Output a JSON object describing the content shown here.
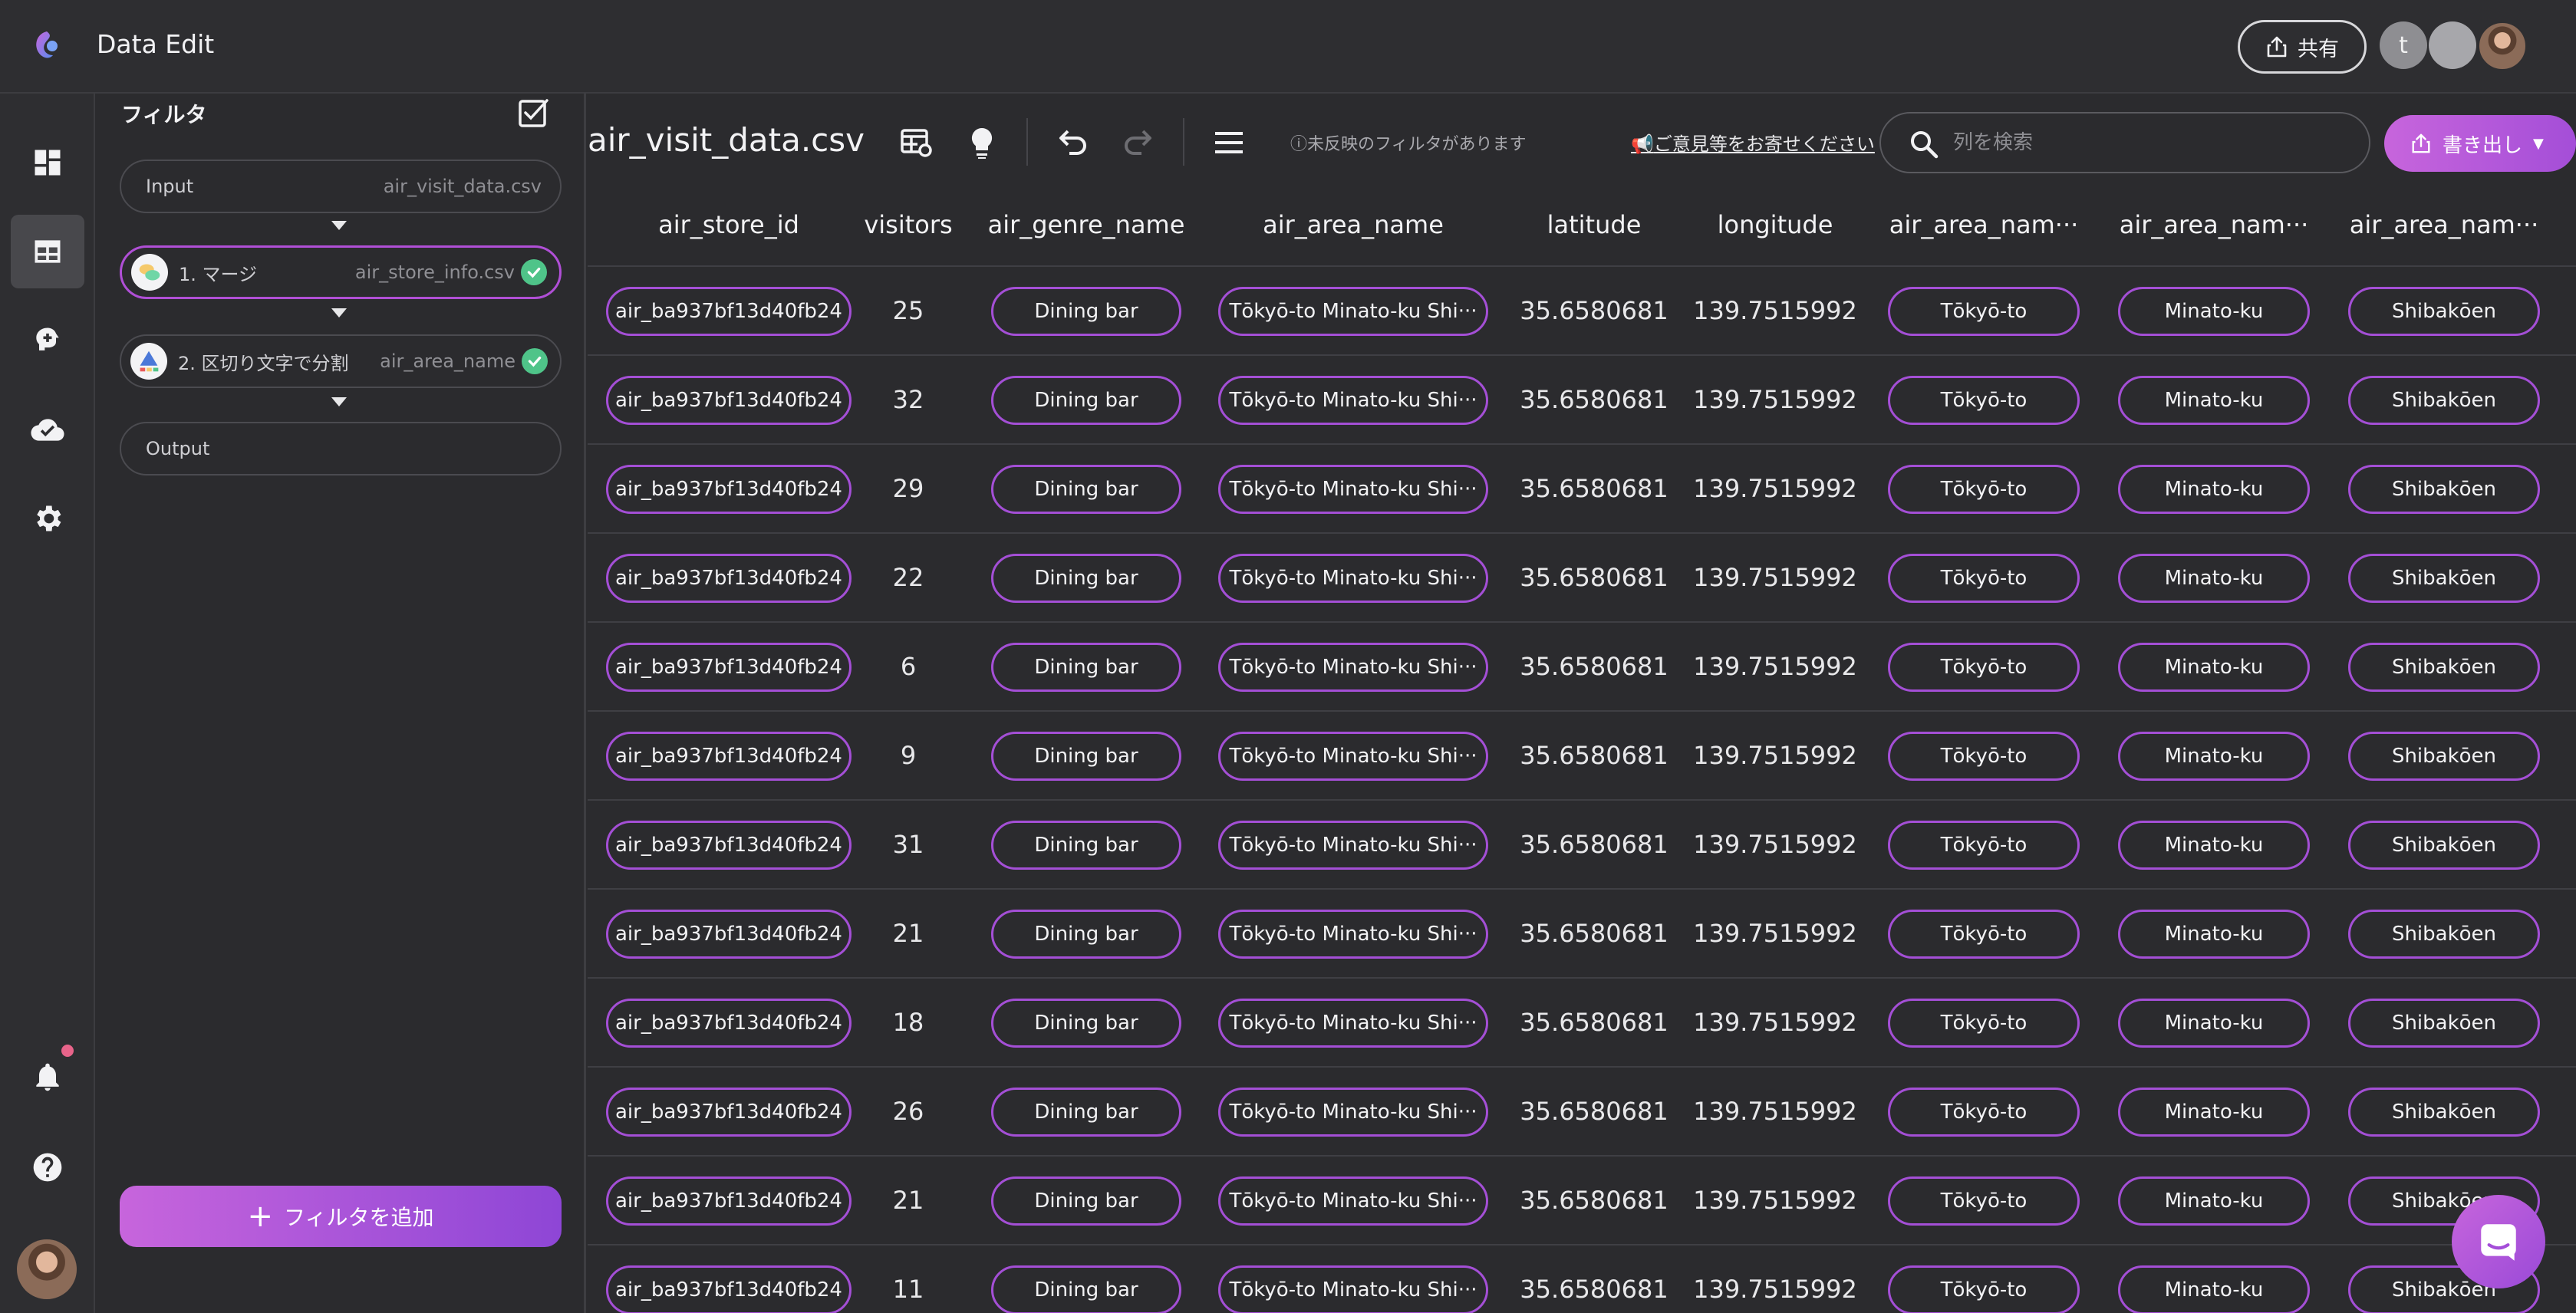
{
  "header": {
    "app_title": "Data Edit",
    "share_label": "共有",
    "user_initial": "t"
  },
  "filter_panel": {
    "title": "フィルタ",
    "input": {
      "label": "Input",
      "file": "air_visit_data.csv"
    },
    "steps": [
      {
        "label": "1. マージ",
        "detail": "air_store_info.csv"
      },
      {
        "label": "2. 区切り文字で分割",
        "detail": "air_area_name"
      }
    ],
    "output": {
      "label": "Output"
    },
    "add_filter_label": "フィルタを追加"
  },
  "toolbar": {
    "file_title": "air_visit_data.csv",
    "unapplied_notice": "ⓘ未反映のフィルタがあります",
    "feedback_link": "ご意見等をお寄せください",
    "search_placeholder": "列を検索",
    "export_label": "書き出し"
  },
  "table": {
    "columns": [
      "air_store_id",
      "visitors",
      "air_genre_name",
      "air_area_name",
      "latitude",
      "longitude",
      "air_area_nam···",
      "air_area_nam···",
      "air_area_nam···"
    ],
    "rows": [
      [
        "air_ba937bf13d40fb24",
        "25",
        "Dining bar",
        "Tōkyō-to Minato-ku Shi···",
        "35.6580681",
        "139.7515992",
        "Tōkyō-to",
        "Minato-ku",
        "Shibakōen"
      ],
      [
        "air_ba937bf13d40fb24",
        "32",
        "Dining bar",
        "Tōkyō-to Minato-ku Shi···",
        "35.6580681",
        "139.7515992",
        "Tōkyō-to",
        "Minato-ku",
        "Shibakōen"
      ],
      [
        "air_ba937bf13d40fb24",
        "29",
        "Dining bar",
        "Tōkyō-to Minato-ku Shi···",
        "35.6580681",
        "139.7515992",
        "Tōkyō-to",
        "Minato-ku",
        "Shibakōen"
      ],
      [
        "air_ba937bf13d40fb24",
        "22",
        "Dining bar",
        "Tōkyō-to Minato-ku Shi···",
        "35.6580681",
        "139.7515992",
        "Tōkyō-to",
        "Minato-ku",
        "Shibakōen"
      ],
      [
        "air_ba937bf13d40fb24",
        "6",
        "Dining bar",
        "Tōkyō-to Minato-ku Shi···",
        "35.6580681",
        "139.7515992",
        "Tōkyō-to",
        "Minato-ku",
        "Shibakōen"
      ],
      [
        "air_ba937bf13d40fb24",
        "9",
        "Dining bar",
        "Tōkyō-to Minato-ku Shi···",
        "35.6580681",
        "139.7515992",
        "Tōkyō-to",
        "Minato-ku",
        "Shibakōen"
      ],
      [
        "air_ba937bf13d40fb24",
        "31",
        "Dining bar",
        "Tōkyō-to Minato-ku Shi···",
        "35.6580681",
        "139.7515992",
        "Tōkyō-to",
        "Minato-ku",
        "Shibakōen"
      ],
      [
        "air_ba937bf13d40fb24",
        "21",
        "Dining bar",
        "Tōkyō-to Minato-ku Shi···",
        "35.6580681",
        "139.7515992",
        "Tōkyō-to",
        "Minato-ku",
        "Shibakōen"
      ],
      [
        "air_ba937bf13d40fb24",
        "18",
        "Dining bar",
        "Tōkyō-to Minato-ku Shi···",
        "35.6580681",
        "139.7515992",
        "Tōkyō-to",
        "Minato-ku",
        "Shibakōen"
      ],
      [
        "air_ba937bf13d40fb24",
        "26",
        "Dining bar",
        "Tōkyō-to Minato-ku Shi···",
        "35.6580681",
        "139.7515992",
        "Tōkyō-to",
        "Minato-ku",
        "Shibakōen"
      ],
      [
        "air_ba937bf13d40fb24",
        "21",
        "Dining bar",
        "Tōkyō-to Minato-ku Shi···",
        "35.6580681",
        "139.7515992",
        "Tōkyō-to",
        "Minato-ku",
        "Shibakōen"
      ],
      [
        "air_ba937bf13d40fb24",
        "11",
        "Dining bar",
        "Tōkyō-to Minato-ku Shi···",
        "35.6580681",
        "139.7515992",
        "Tōkyō-to",
        "Minato-ku",
        "Shibakōen"
      ]
    ]
  },
  "colors": {
    "accent": "#a44fd6",
    "background": "#2b2b2e",
    "success": "#4fc489"
  }
}
